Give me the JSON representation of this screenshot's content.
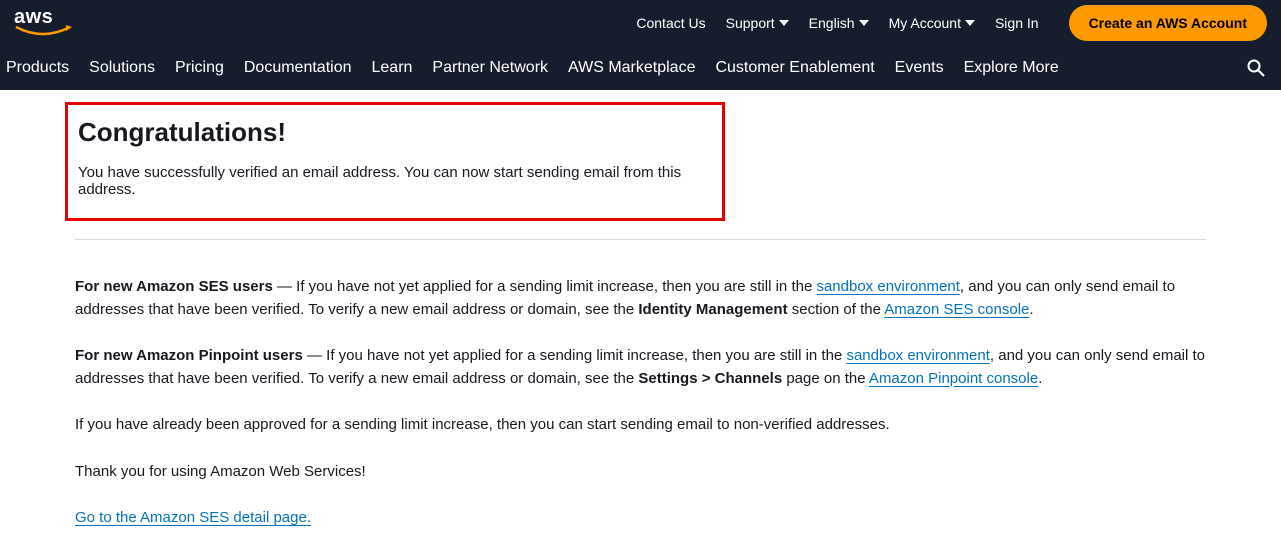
{
  "header": {
    "logo_text": "aws",
    "top_links": {
      "contact": "Contact Us",
      "support": "Support",
      "language": "English",
      "account": "My Account",
      "signin": "Sign In"
    },
    "cta": "Create an AWS Account",
    "nav": {
      "products": "Products",
      "solutions": "Solutions",
      "pricing": "Pricing",
      "documentation": "Documentation",
      "learn": "Learn",
      "partner": "Partner Network",
      "marketplace": "AWS Marketplace",
      "enablement": "Customer Enablement",
      "events": "Events",
      "explore": "Explore More"
    }
  },
  "hero": {
    "title": "Congratulations!",
    "subtitle": "You have successfully verified an email address. You can now start sending email from this address."
  },
  "body": {
    "p1_strong": "For new Amazon SES users",
    "p1_a": " — If you have not yet applied for a sending limit increase, then you are still in the ",
    "p1_link1": "sandbox environment",
    "p1_b": ", and you can only send email to addresses that have been verified. To verify a new email address or domain, see the ",
    "p1_strong2": "Identity Management",
    "p1_c": " section of the ",
    "p1_link2": "Amazon SES console",
    "p1_end": ".",
    "p2_strong": "For new Amazon Pinpoint users",
    "p2_a": " — If you have not yet applied for a sending limit increase, then you are still in the ",
    "p2_link1": "sandbox environment",
    "p2_b": ", and you can only send email to addresses that have been verified. To verify a new email address or domain, see the ",
    "p2_strong2": "Settings > Channels",
    "p2_c": " page on the ",
    "p2_link2": "Amazon Pinpoint console",
    "p2_end": ".",
    "p3": "If you have already been approved for a sending limit increase, then you can start sending email to non-verified addresses.",
    "p4": "Thank you for using Amazon Web Services!",
    "detail_link": "Go to the Amazon SES detail page."
  }
}
